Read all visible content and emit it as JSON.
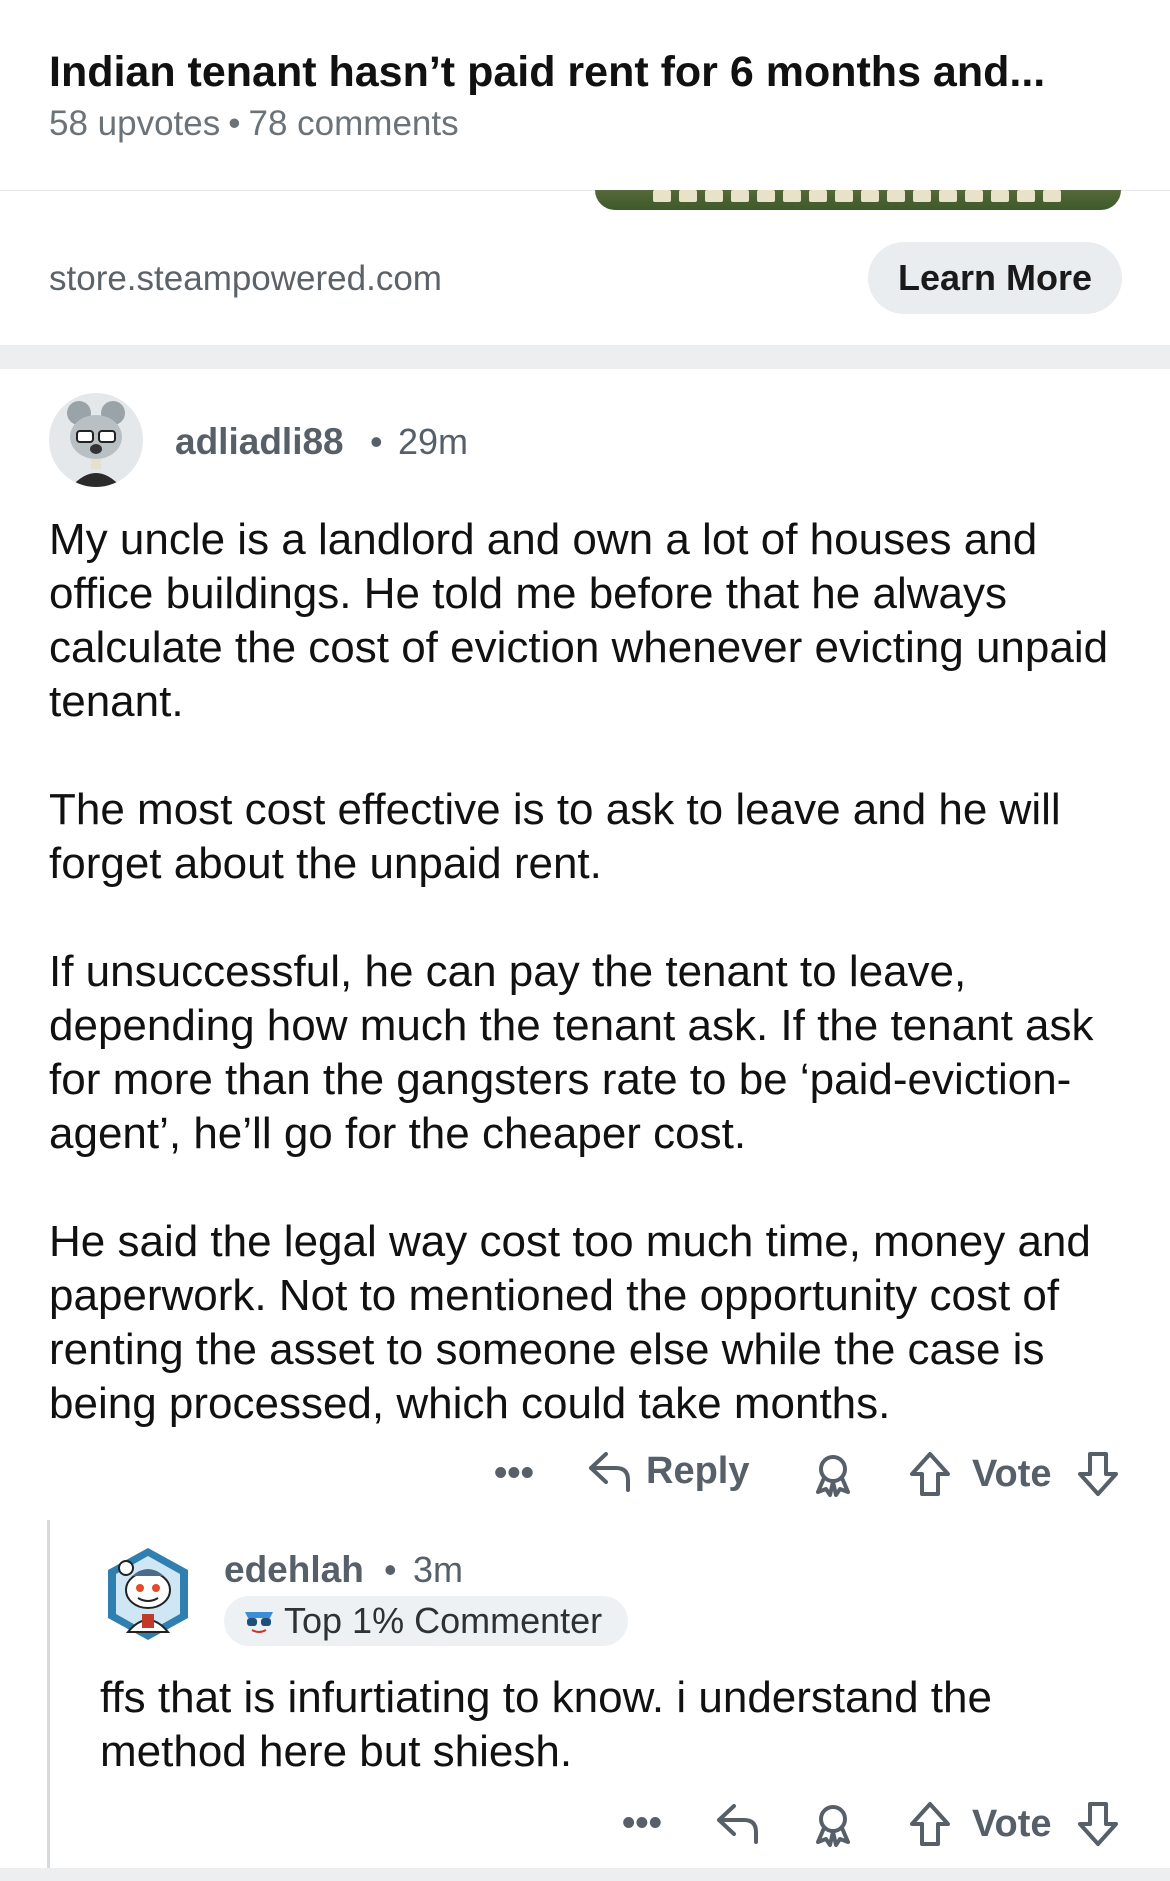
{
  "post": {
    "title": "Indian tenant hasn’t paid rent for 6 months and...",
    "upvotes": "58 upvotes",
    "separator": "•",
    "comments": "78 comments"
  },
  "ad": {
    "domain": "store.steampowered.com",
    "cta_label": "Learn More"
  },
  "comments": [
    {
      "username": "adliadli88",
      "separator": "•",
      "time": "29m",
      "paragraphs": [
        "My uncle is a landlord and own a lot of houses and office buildings. He told me before that he always calculate the cost of eviction whenever evicting unpaid tenant.",
        "The most cost effective is to ask to leave and he will forget about the unpaid rent.",
        "If unsuccessful, he can pay the tenant to leave, depending how much the tenant ask. If the tenant ask for more than the gangsters rate to be ‘paid-eviction-agent’, he’ll go for the cheaper cost.",
        "He said the legal way cost too much time, money and paperwork. Not to mentioned the opportunity cost of renting the asset to someone else while the case is being processed, which could take months."
      ],
      "actions": {
        "more": "•••",
        "reply": "Reply",
        "vote": "Vote"
      }
    },
    {
      "username": "edehlah",
      "separator": "•",
      "time": "3m",
      "flair": "Top 1% Commenter",
      "paragraphs": [
        "ffs that is infurtiating to know. i understand the method here but shiesh."
      ],
      "actions": {
        "more": "•••",
        "vote": "Vote"
      }
    }
  ],
  "icons": {
    "reply": "reply-arrow-icon",
    "award": "award-icon",
    "upvote": "upvote-arrow-icon",
    "downvote": "downvote-arrow-icon",
    "flair": "sunglasses-icon"
  },
  "colors": {
    "meta_gray": "#576069",
    "button_bg": "#e9edf0",
    "divider": "#eceef0"
  }
}
